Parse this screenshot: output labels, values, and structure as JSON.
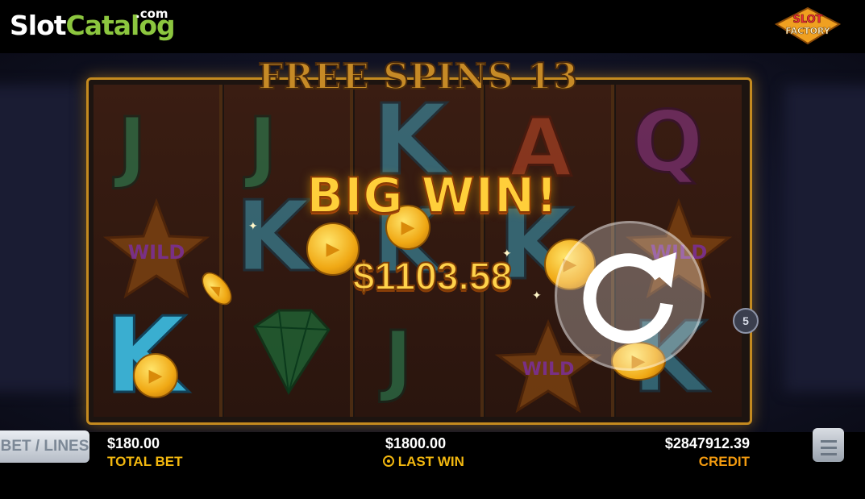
{
  "branding": {
    "site_part1": "Slot",
    "site_part2": "Catalog",
    "site_tld": ".com",
    "provider_logo": "SLOT FACTORY"
  },
  "game": {
    "free_spins_label": "FREE SPINS 13",
    "big_win_label": "BIG WIN!",
    "win_amount": "$1103.58",
    "paylines_badge": "5",
    "reels": [
      [
        "J",
        "WILD",
        "K"
      ],
      [
        "J",
        "K",
        "diamond"
      ],
      [
        "K",
        "K",
        "J"
      ],
      [
        "A",
        "K",
        "WILD"
      ],
      [
        "Q",
        "WILD",
        "K"
      ]
    ]
  },
  "controls": {
    "bet_lines_label": "BET / LINES",
    "total_bet_value": "$180.00",
    "total_bet_label": "TOTAL BET",
    "last_win_value": "$1800.00",
    "last_win_label": "LAST WIN",
    "credit_value": "$2847912.39",
    "credit_label": "CREDIT",
    "spin_icon": "refresh-icon",
    "menu_icon": "hamburger-icon"
  },
  "colors": {
    "accent_gold": "#f2b70f",
    "frame_gold": "#c48a1f",
    "brand_green": "#8cc63f"
  }
}
